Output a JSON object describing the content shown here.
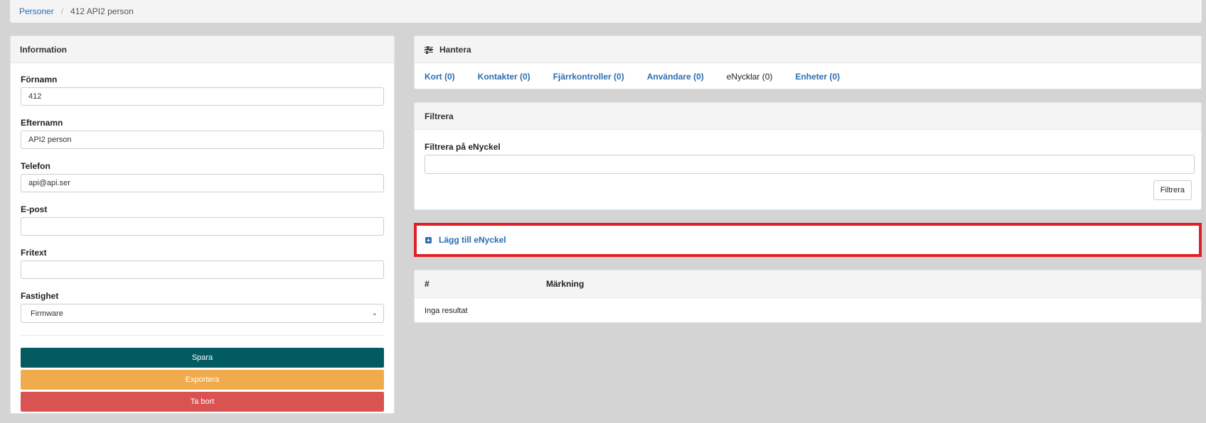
{
  "breadcrumb": {
    "parent": "Personer",
    "current": "412 API2 person"
  },
  "info": {
    "title": "Information",
    "fields": {
      "first_name": {
        "label": "Förnamn",
        "value": "412"
      },
      "last_name": {
        "label": "Efternamn",
        "value": "API2 person"
      },
      "phone": {
        "label": "Telefon",
        "value": "api@api.ser"
      },
      "email": {
        "label": "E-post",
        "value": ""
      },
      "free_text": {
        "label": "Fritext",
        "value": ""
      },
      "property": {
        "label": "Fastighet",
        "value": "Firmware"
      }
    },
    "buttons": {
      "save": "Spara",
      "export": "Exportera",
      "delete": "Ta bort"
    },
    "colors": {
      "save": "#035a60",
      "export": "#f0ab4d",
      "delete": "#d85352"
    }
  },
  "manage": {
    "title": "Hantera",
    "icon": "sliders-icon",
    "tabs": [
      {
        "label": "Kort (0)",
        "active": false
      },
      {
        "label": "Kontakter (0)",
        "active": false
      },
      {
        "label": "Fjärrkontroller (0)",
        "active": false
      },
      {
        "label": "Användare (0)",
        "active": false
      },
      {
        "label": "eNycklar (0)",
        "active": true
      },
      {
        "label": "Enheter (0)",
        "active": false
      }
    ]
  },
  "filter": {
    "title": "Filtrera",
    "field_label": "Filtrera på eNyckel",
    "value": "",
    "button": "Filtrera"
  },
  "add_key": {
    "label": "Lägg till eNyckel",
    "icon": "plus-square-icon",
    "highlight_color": "#e01f26"
  },
  "results": {
    "columns": [
      "#",
      "Märkning"
    ],
    "empty_text": "Inga resultat"
  }
}
